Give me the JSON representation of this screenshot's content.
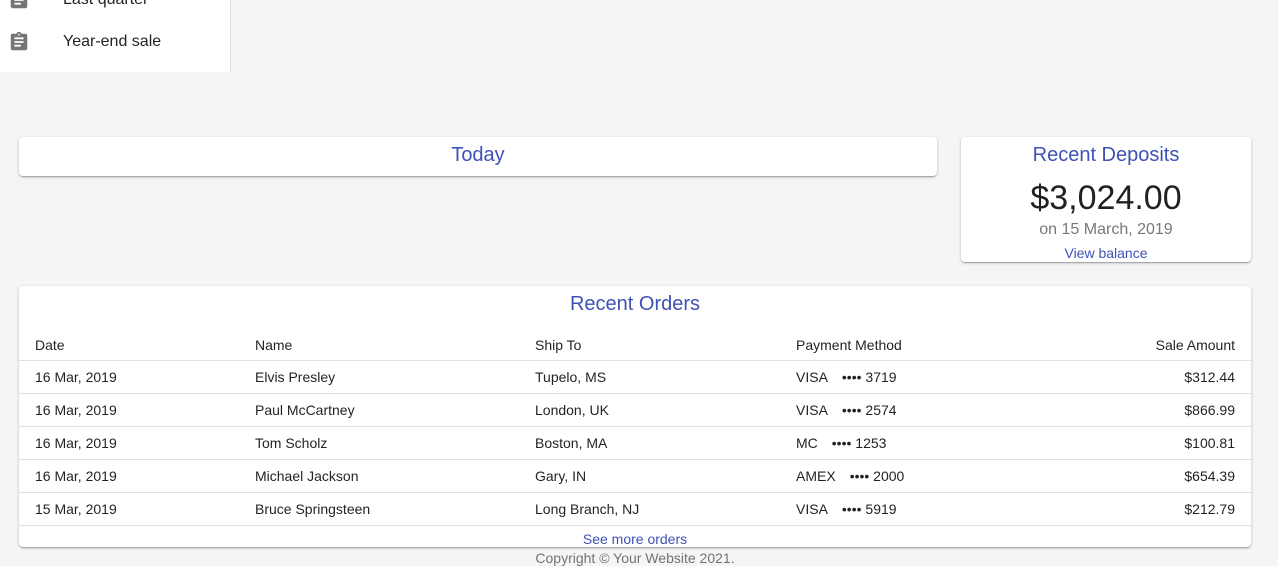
{
  "drawer": {
    "items": [
      {
        "label": "Last quarter",
        "icon": "assignment-icon"
      },
      {
        "label": "Year-end sale",
        "icon": "assignment-icon"
      }
    ]
  },
  "today": {
    "title": "Today"
  },
  "deposits": {
    "title": "Recent Deposits",
    "amount": "$3,024.00",
    "date": "on 15 March, 2019",
    "link": "View balance"
  },
  "orders": {
    "title": "Recent Orders",
    "columns": [
      "Date",
      "Name",
      "Ship To",
      "Payment Method",
      "Sale Amount"
    ],
    "rows": [
      {
        "date": "16 Mar, 2019",
        "name": "Elvis Presley",
        "ship": "Tupelo, MS",
        "brand": "VISA",
        "card": "•••• 3719",
        "amount": "$312.44"
      },
      {
        "date": "16 Mar, 2019",
        "name": "Paul McCartney",
        "ship": "London, UK",
        "brand": "VISA",
        "card": "•••• 2574",
        "amount": "$866.99"
      },
      {
        "date": "16 Mar, 2019",
        "name": "Tom Scholz",
        "ship": "Boston, MA",
        "brand": "MC",
        "card": "•••• 1253",
        "amount": "$100.81"
      },
      {
        "date": "16 Mar, 2019",
        "name": "Michael Jackson",
        "ship": "Gary, IN",
        "brand": "AMEX",
        "card": "•••• 2000",
        "amount": "$654.39"
      },
      {
        "date": "15 Mar, 2019",
        "name": "Bruce Springsteen",
        "ship": "Long Branch, NJ",
        "brand": "VISA",
        "card": "•••• 5919",
        "amount": "$212.79"
      }
    ],
    "more": "See more orders"
  },
  "footer": {
    "copyright": "Copyright © Your Website 2021."
  },
  "colors": {
    "primary": "#3f51b5",
    "background": "#f5f5f5"
  }
}
